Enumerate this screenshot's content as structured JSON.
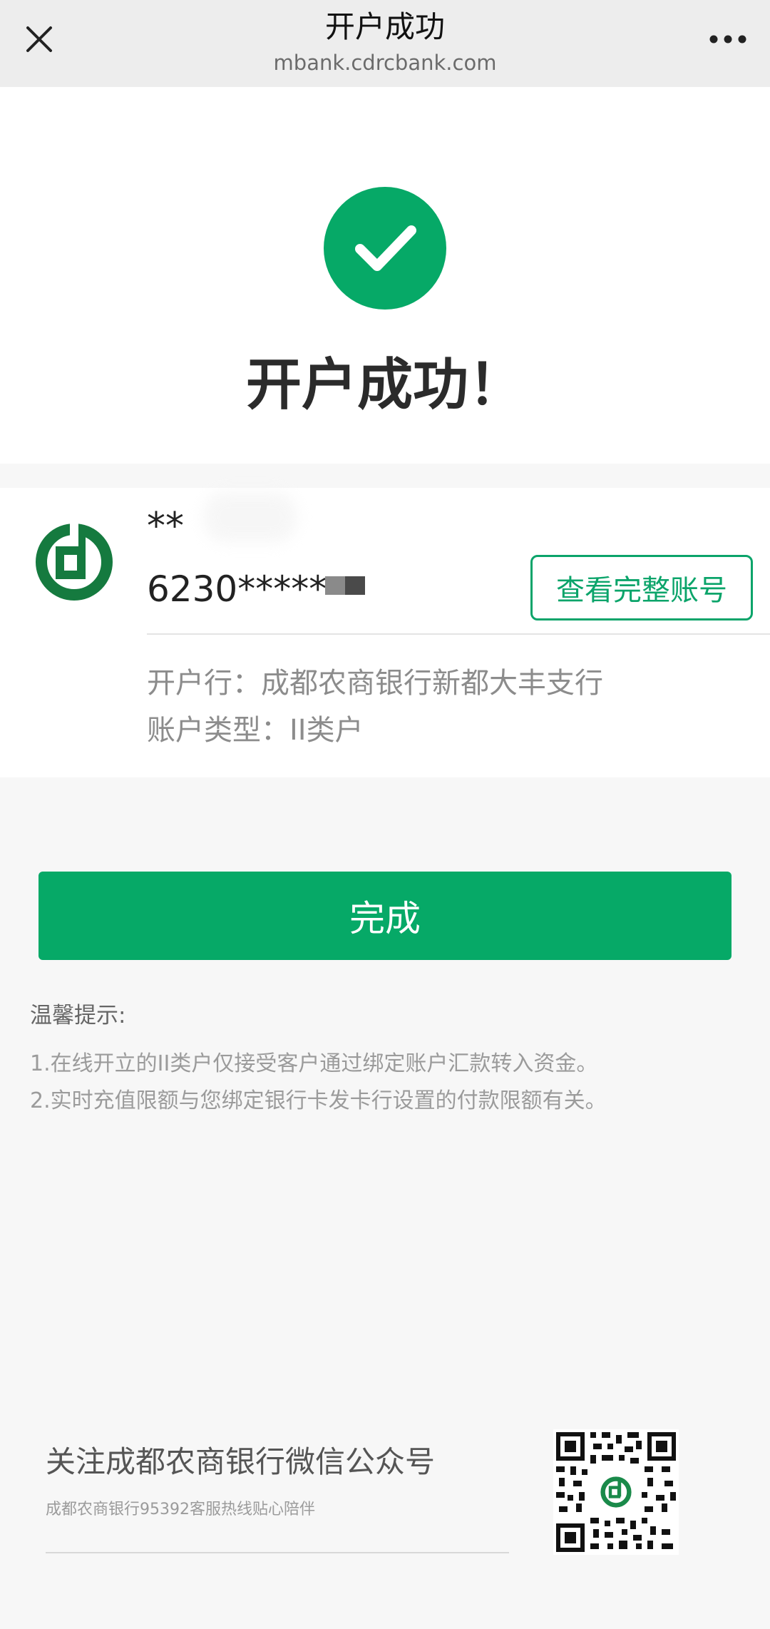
{
  "topbar": {
    "title": "开户成功",
    "url": "mbank.cdrcbank.com",
    "close_icon": "close-icon",
    "more_icon": "more-icon"
  },
  "hero": {
    "title": "开户成功！",
    "icon": "check-circle-icon"
  },
  "account": {
    "name_masked": "**",
    "number_masked": "6230*****",
    "view_full_label": "查看完整账号",
    "branch_label": "开户行：成都农商银行新都大丰支行",
    "type_label": "账户类型：II类户",
    "logo_icon": "bank-logo-icon"
  },
  "actions": {
    "done_label": "完成"
  },
  "tips": {
    "title": "温馨提示:",
    "items": [
      "1.在线开立的II类户仅接受客户通过绑定账户汇款转入资金。",
      "2.实时充值限额与您绑定银行卡发卡行设置的付款限额有关。"
    ]
  },
  "footer": {
    "follow_text": "关注成都农商银行微信公众号",
    "hotline_text": "成都农商银行95392客服热线贴心陪伴",
    "qr_icon": "qr-code-icon"
  },
  "colors": {
    "brand_green": "#06a967",
    "text_dark": "#222222",
    "text_muted": "#8c8c8c"
  }
}
